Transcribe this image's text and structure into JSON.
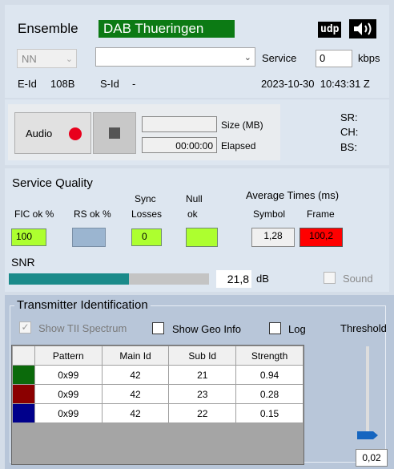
{
  "header": {
    "ensemble_label": "Ensemble",
    "ensemble_name": "DAB Thueringen",
    "udp_label": "udp",
    "speaker_icon": "speaker-icon",
    "nn_value": "NN",
    "service_combo_value": "",
    "service_label": "Service",
    "kbps_value": "0",
    "kbps_label": "kbps",
    "eid_label": "E-Id",
    "eid_value": "108B",
    "sid_label": "S-Id",
    "sid_value": "-",
    "datetime": "2023-10-30  10:43:31 Z"
  },
  "recording": {
    "audio_button": "Audio",
    "size_value": "",
    "size_label": "Size (MB)",
    "elapsed_value": "00:00:00",
    "elapsed_label": "Elapsed",
    "sr_label": "SR:",
    "ch_label": "CH:",
    "bs_label": "BS:"
  },
  "service_quality": {
    "title": "Service Quality",
    "fic_label": "FIC ok %",
    "rs_label": "RS ok %",
    "sync_label_1": "Sync",
    "sync_label_2": "Losses",
    "null_label_1": "Null",
    "null_label_2": "ok",
    "avg_title": "Average Times (ms)",
    "symbol_label": "Symbol",
    "frame_label": "Frame",
    "fic_value": "100",
    "rs_value": "",
    "sync_value": "0",
    "null_value": "",
    "symbol_value": "1,28",
    "frame_value": "100,2",
    "snr_label": "SNR",
    "snr_value": "21,8",
    "snr_unit": "dB",
    "snr_fraction": 0.6,
    "sound_label": "Sound",
    "colors": {
      "ok": "#adff2f",
      "rs": "#9bb5d0",
      "frame": "#ff0000"
    }
  },
  "tii": {
    "title": "Transmitter Identification",
    "show_spectrum_label": "Show TII Spectrum",
    "show_geo_label": "Show Geo Info",
    "log_label": "Log",
    "threshold_label": "Threshold",
    "threshold_value": "0,02",
    "columns": [
      "Pattern",
      "Main Id",
      "Sub Id",
      "Strength"
    ],
    "rows": [
      {
        "color": "#0b6a0b",
        "pattern": "0x99",
        "main": "42",
        "sub": "21",
        "strength": "0.94"
      },
      {
        "color": "#8b0000",
        "pattern": "0x99",
        "main": "42",
        "sub": "23",
        "strength": "0.28"
      },
      {
        "color": "#00008b",
        "pattern": "0x99",
        "main": "42",
        "sub": "22",
        "strength": "0.15"
      }
    ]
  }
}
